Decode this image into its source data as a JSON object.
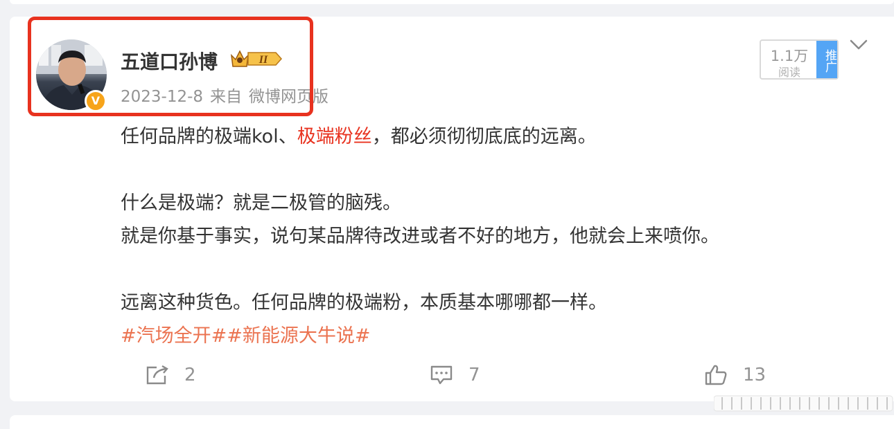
{
  "post": {
    "author": {
      "name": "五道口孙博",
      "badge_level": "II",
      "verified_mark": "V"
    },
    "meta": {
      "date": "2023-12-8",
      "source_prefix": "来自",
      "source": "微博网页版"
    },
    "reads": {
      "count": "1.1万",
      "label": "阅读",
      "promote_label": "推广"
    },
    "content": {
      "line1_before": "任何品牌的极端kol、",
      "line1_highlight": "极端粉丝",
      "line1_after": "，都必须彻彻底底的远离。",
      "line2": "什么是极端？就是二极管的脑残。",
      "line3": "就是你基于事实，说句某品牌待改进或者不好的地方，他就会上来喷你。",
      "line4": "远离这种货色。任何品牌的极端粉，本质基本哪哪都一样。",
      "topics": "#汽场全开##新能源大牛说#"
    },
    "actions": {
      "reposts": "2",
      "comments": "7",
      "likes": "13"
    }
  },
  "colors": {
    "highlight_border": "#e8321f",
    "topic": "#eb7350",
    "promote_bg": "#54a5f5",
    "verified": "#f7a41a"
  }
}
